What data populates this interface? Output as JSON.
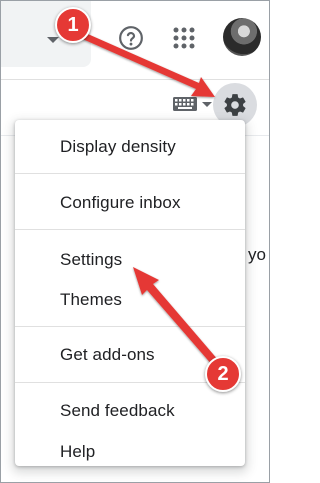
{
  "header": {
    "search_caret_icon": "caret-down-icon",
    "help_icon": "help-circle-icon",
    "apps_icon": "apps-grid-icon",
    "avatar_icon": "user-avatar"
  },
  "toolbar": {
    "keyboard_icon": "keyboard-icon",
    "settings_icon": "gear-icon"
  },
  "background": {
    "partial_text": "yo"
  },
  "menu": {
    "items": [
      {
        "label": "Display density"
      },
      {
        "label": "Configure inbox"
      },
      {
        "label": "Settings"
      },
      {
        "label": "Themes"
      },
      {
        "label": "Get add-ons"
      },
      {
        "label": "Send feedback"
      },
      {
        "label": "Help"
      }
    ]
  },
  "annotations": {
    "badge_1": "1",
    "badge_2": "2",
    "color": "#e53935"
  }
}
